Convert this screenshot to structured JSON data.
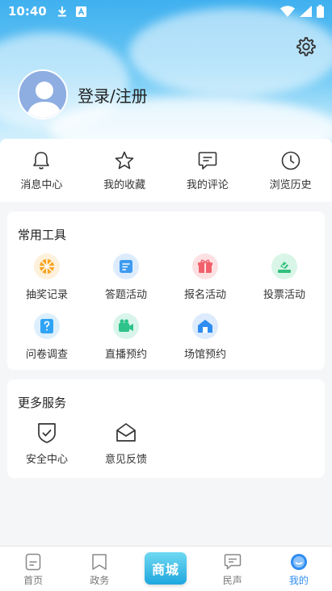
{
  "status_bar": {
    "time": "10:40",
    "icons": [
      "download-icon",
      "keyboard-a-icon",
      "wifi-icon",
      "signal-icon",
      "battery-icon"
    ]
  },
  "profile": {
    "login_label": "登录/注册"
  },
  "quick_actions": [
    {
      "label": "消息中心",
      "icon": "bell-icon"
    },
    {
      "label": "我的收藏",
      "icon": "star-icon"
    },
    {
      "label": "我的评论",
      "icon": "comment-icon"
    },
    {
      "label": "浏览历史",
      "icon": "clock-icon"
    }
  ],
  "tools": {
    "title": "常用工具",
    "items": [
      {
        "label": "抽奖记录",
        "icon": "lottery-icon",
        "color": "#f7a624"
      },
      {
        "label": "答题活动",
        "icon": "quiz-icon",
        "color": "#3d9bf0"
      },
      {
        "label": "报名活动",
        "icon": "gift-icon",
        "color": "#f2616b"
      },
      {
        "label": "投票活动",
        "icon": "vote-icon",
        "color": "#30c07c"
      },
      {
        "label": "问卷调查",
        "icon": "question-icon",
        "color": "#2fa4f4"
      },
      {
        "label": "直播预约",
        "icon": "live-icon",
        "color": "#2fc38a"
      },
      {
        "label": "场馆预约",
        "icon": "venue-icon",
        "color": "#2f8df2"
      }
    ]
  },
  "services": {
    "title": "更多服务",
    "items": [
      {
        "label": "安全中心",
        "icon": "shield-icon"
      },
      {
        "label": "意见反馈",
        "icon": "envelope-icon"
      }
    ]
  },
  "bottom_nav": {
    "items": [
      {
        "label": "首页",
        "icon": "home-doc-icon"
      },
      {
        "label": "政务",
        "icon": "bookmark-icon"
      },
      {
        "label": "民声",
        "icon": "chat-icon"
      },
      {
        "label": "我的",
        "icon": "me-icon"
      }
    ],
    "mall_label": "商城",
    "active": "我的",
    "accent": "#2f8df2"
  }
}
